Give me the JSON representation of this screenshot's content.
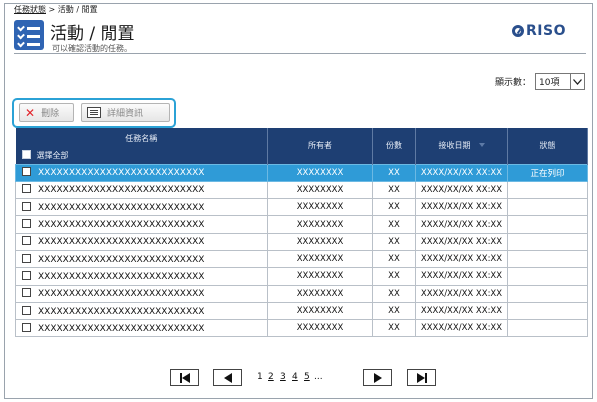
{
  "breadcrumb": {
    "parent": "任務狀態",
    "separator": ">",
    "current": "活動 / 閒置"
  },
  "page": {
    "title": "活動 / 閒置",
    "subtitle": "可以確認活動的任務。"
  },
  "logo": {
    "text": "RISO",
    "icon": "riso-logo-icon"
  },
  "display_count": {
    "label": "顯示數：",
    "selected": "10項",
    "icon": "chevron-down-icon"
  },
  "toolbar": {
    "delete_label": "刪除",
    "delete_icon": "close-icon",
    "detail_label": "詳細資訊",
    "detail_icon": "list-icon",
    "focus_color": "#2ba2d6"
  },
  "table": {
    "headers": {
      "name": "任務名稱",
      "owner": "所有者",
      "copies": "份數",
      "received": "接收日期",
      "status": "狀態"
    },
    "select_all": "選擇全部",
    "rows": [
      {
        "name": "XXXXXXXXXXXXXXXXXXXXXXXXXXX",
        "owner": "XXXXXXXX",
        "copies": "XX",
        "received": "XXXX/XX/XX XX:XX",
        "status": "正在列印"
      },
      {
        "name": "XXXXXXXXXXXXXXXXXXXXXXXXXXX",
        "owner": "XXXXXXXX",
        "copies": "XX",
        "received": "XXXX/XX/XX XX:XX",
        "status": ""
      },
      {
        "name": "XXXXXXXXXXXXXXXXXXXXXXXXXXX",
        "owner": "XXXXXXXX",
        "copies": "XX",
        "received": "XXXX/XX/XX XX:XX",
        "status": ""
      },
      {
        "name": "XXXXXXXXXXXXXXXXXXXXXXXXXXX",
        "owner": "XXXXXXXX",
        "copies": "XX",
        "received": "XXXX/XX/XX XX:XX",
        "status": ""
      },
      {
        "name": "XXXXXXXXXXXXXXXXXXXXXXXXXXX",
        "owner": "XXXXXXXX",
        "copies": "XX",
        "received": "XXXX/XX/XX XX:XX",
        "status": ""
      },
      {
        "name": "XXXXXXXXXXXXXXXXXXXXXXXXXXX",
        "owner": "XXXXXXXX",
        "copies": "XX",
        "received": "XXXX/XX/XX XX:XX",
        "status": ""
      },
      {
        "name": "XXXXXXXXXXXXXXXXXXXXXXXXXXX",
        "owner": "XXXXXXXX",
        "copies": "XX",
        "received": "XXXX/XX/XX XX:XX",
        "status": ""
      },
      {
        "name": "XXXXXXXXXXXXXXXXXXXXXXXXXXX",
        "owner": "XXXXXXXX",
        "copies": "XX",
        "received": "XXXX/XX/XX XX:XX",
        "status": ""
      },
      {
        "name": "XXXXXXXXXXXXXXXXXXXXXXXXXXX",
        "owner": "XXXXXXXX",
        "copies": "XX",
        "received": "XXXX/XX/XX XX:XX",
        "status": ""
      },
      {
        "name": "XXXXXXXXXXXXXXXXXXXXXXXXXXX",
        "owner": "XXXXXXXX",
        "copies": "XX",
        "received": "XXXX/XX/XX XX:XX",
        "status": ""
      }
    ],
    "header_color": "#1e3f73",
    "selected_row_color": "#2f9bd7"
  },
  "pager": {
    "first_icon": "first-page-icon",
    "prev_icon": "prev-page-icon",
    "next_icon": "next-page-icon",
    "last_icon": "last-page-icon",
    "current_page": "1",
    "pages": [
      "2",
      "3",
      "4",
      "5"
    ],
    "ellipsis": "..."
  }
}
